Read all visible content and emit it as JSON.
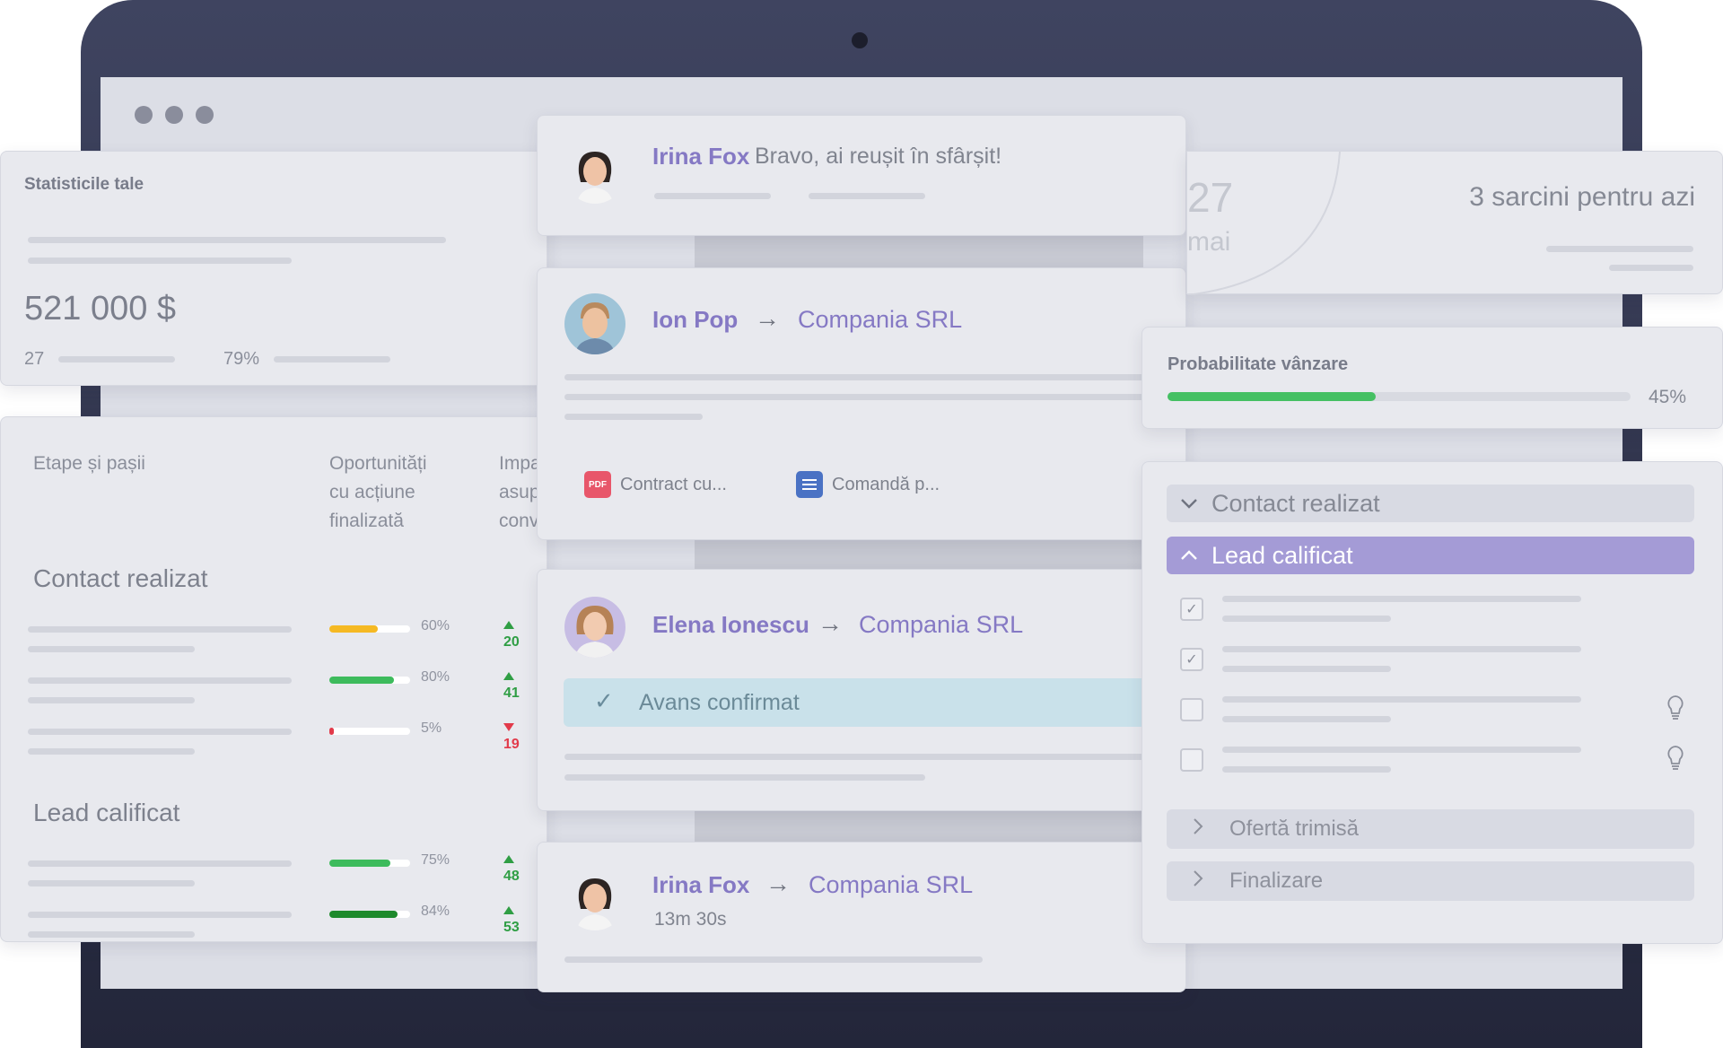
{
  "stats": {
    "title": "Statisticile tale",
    "amount": "521 000 $",
    "count": "27",
    "percent": "79%"
  },
  "stages_table": {
    "col1": "Etape și pașii",
    "col2_lines": [
      "Oportunități",
      "cu acțiune",
      "finalizată"
    ],
    "col3_lines": [
      "Impa",
      "asup",
      "conv"
    ],
    "groups": [
      {
        "title": "Contact realizat",
        "rows": [
          {
            "percent": "60%",
            "value": 60,
            "color": "#f5b923",
            "impact": "20",
            "trend": "up"
          },
          {
            "percent": "80%",
            "value": 80,
            "color": "#3dbb5c",
            "impact": "41",
            "trend": "up"
          },
          {
            "percent": "5%",
            "value": 5,
            "color": "#e23a4a",
            "impact": "19",
            "trend": "down"
          }
        ]
      },
      {
        "title": "Lead calificat",
        "rows": [
          {
            "percent": "75%",
            "value": 75,
            "color": "#3dbb5c",
            "impact": "48",
            "trend": "up"
          },
          {
            "percent": "84%",
            "value": 84,
            "color": "#1e8a2c",
            "impact": "53",
            "trend": "up"
          }
        ]
      }
    ]
  },
  "feed": {
    "message_card": {
      "name": "Irina Fox",
      "text": "Bravo, ai reușit în sfârșit!"
    },
    "deal_card_1": {
      "name": "Ion Pop",
      "company": "Compania SRL",
      "attachments": [
        {
          "label": "Contract cu...",
          "icon": "pdf-icon",
          "icon_text": "PDF"
        },
        {
          "label": "Comandă p...",
          "icon": "document-icon"
        }
      ]
    },
    "deal_card_2": {
      "name": "Elena Ionescu",
      "company": "Compania SRL",
      "status": "Avans confirmat"
    },
    "deal_card_3": {
      "name": "Irina Fox",
      "company": "Compania SRL",
      "duration": "13m 30s"
    },
    "arrow": "→"
  },
  "calendar": {
    "day": "27",
    "month": "mai",
    "tasks": "3 sarcini pentru azi"
  },
  "probability": {
    "title": "Probabilitate vânzare",
    "value": 45,
    "label": "45%",
    "color": "#45c063"
  },
  "pipeline": {
    "stages": [
      {
        "label": "Contact realizat",
        "state": "collapsed"
      },
      {
        "label": "Lead calificat",
        "state": "expanded",
        "color": "#a49bd6"
      },
      {
        "label": "Ofertă trimisă",
        "state": "closed"
      },
      {
        "label": "Finalizare",
        "state": "closed"
      }
    ],
    "checklist": [
      {
        "checked": true,
        "hint": false
      },
      {
        "checked": true,
        "hint": false
      },
      {
        "checked": false,
        "hint": true
      },
      {
        "checked": false,
        "hint": true
      }
    ]
  }
}
